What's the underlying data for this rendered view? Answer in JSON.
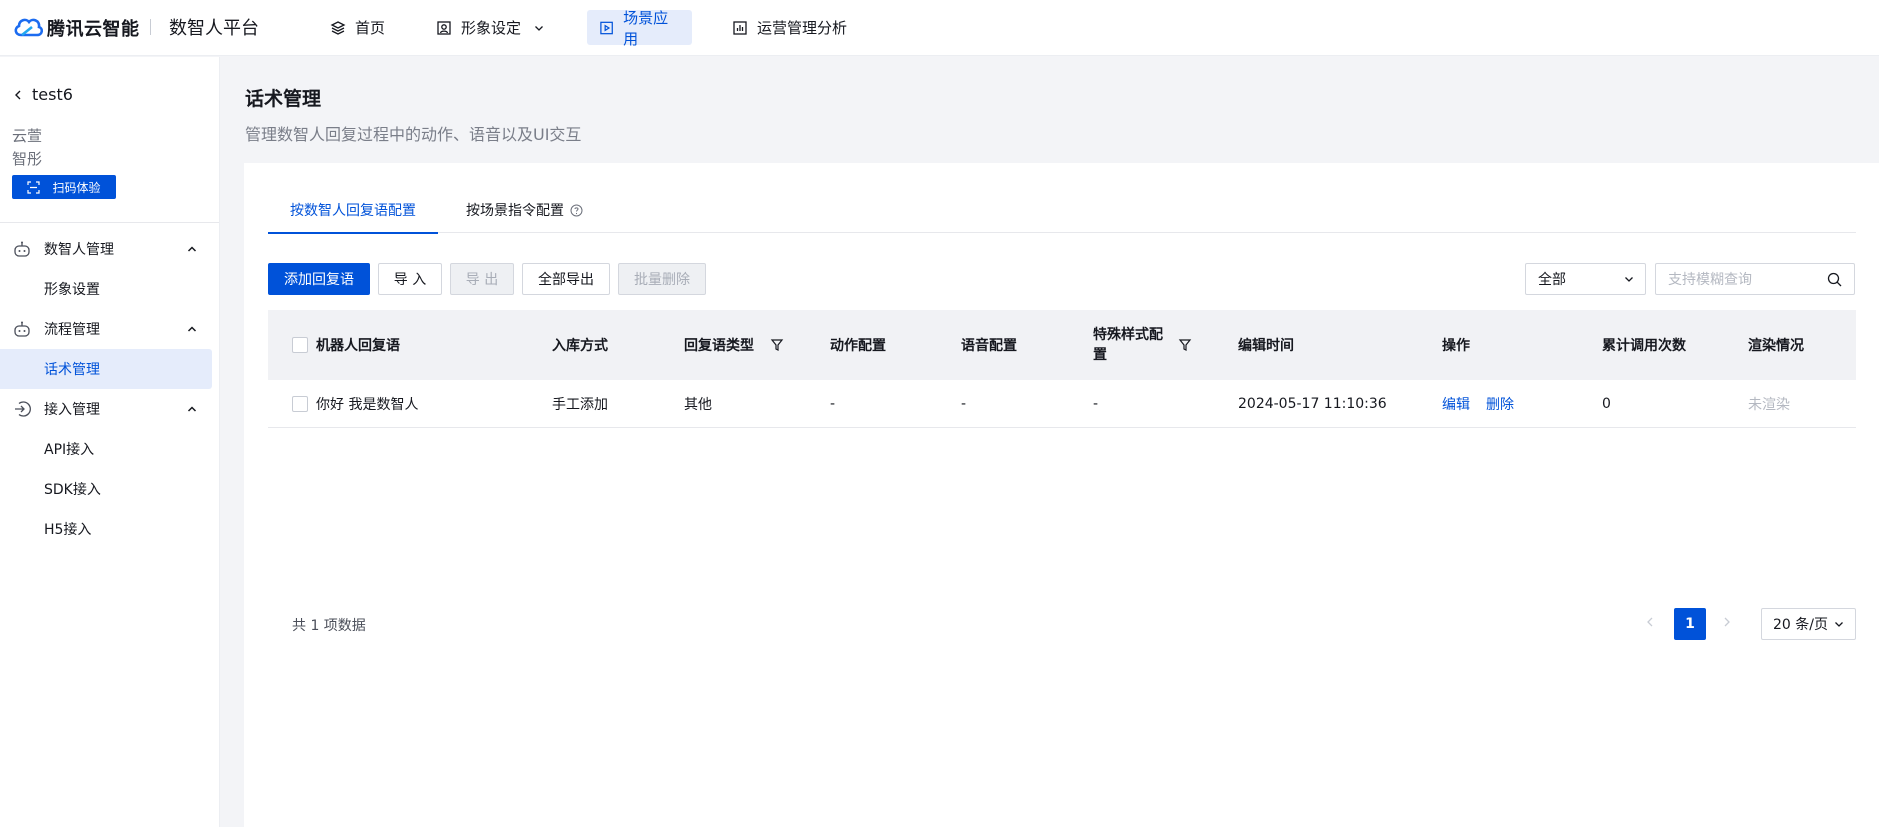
{
  "header": {
    "brand": "腾讯云智能",
    "platform": "数智人平台",
    "nav": [
      {
        "label": "首页",
        "icon": "layers-icon"
      },
      {
        "label": "形象设定",
        "icon": "portrait-icon"
      },
      {
        "label": "场景应用",
        "icon": "play-icon"
      },
      {
        "label": "运营管理分析",
        "icon": "chart-icon"
      }
    ]
  },
  "sidebar": {
    "back_label": "test6",
    "line1": "云萱",
    "line2": "智彤",
    "scan_label": "扫码体验",
    "groups": [
      {
        "label": "数智人管理",
        "icon": "robot-icon",
        "items": [
          "形象设置"
        ]
      },
      {
        "label": "流程管理",
        "icon": "robot-icon",
        "items": [
          "话术管理"
        ]
      },
      {
        "label": "接入管理",
        "icon": "login-icon",
        "items": [
          "API接入",
          "SDK接入",
          "H5接入"
        ]
      }
    ],
    "active_item": "话术管理"
  },
  "page": {
    "title": "话术管理",
    "subtitle": "管理数智人回复过程中的动作、语音以及UI交互"
  },
  "tabs": [
    {
      "label": "按数智人回复语配置"
    },
    {
      "label": "按场景指令配置"
    }
  ],
  "toolbar": {
    "add": "添加回复语",
    "import": "导 入",
    "export": "导 出",
    "export_all": "全部导出",
    "batch_delete": "批量删除",
    "filter_value": "全部",
    "search_placeholder": "支持模糊查询"
  },
  "table": {
    "columns": [
      "机器人回复语",
      "入库方式",
      "回复语类型",
      "动作配置",
      "语音配置",
      "特殊样式配置",
      "编辑时间",
      "操作",
      "累计调用次数",
      "渲染情况"
    ],
    "rows": [
      {
        "reply": "你好 我是数智人",
        "method": "手工添加",
        "type": "其他",
        "action": "-",
        "voice": "-",
        "style": "-",
        "time": "2024-05-17 11:10:36",
        "edit": "编辑",
        "delete": "删除",
        "count": "0",
        "render": "未渲染"
      }
    ]
  },
  "pagination": {
    "total": "共 1 项数据",
    "current": "1",
    "page_size": "20 条/页"
  },
  "colors": {
    "accent": "#0052d9",
    "page_bg": "#f3f4f7"
  }
}
